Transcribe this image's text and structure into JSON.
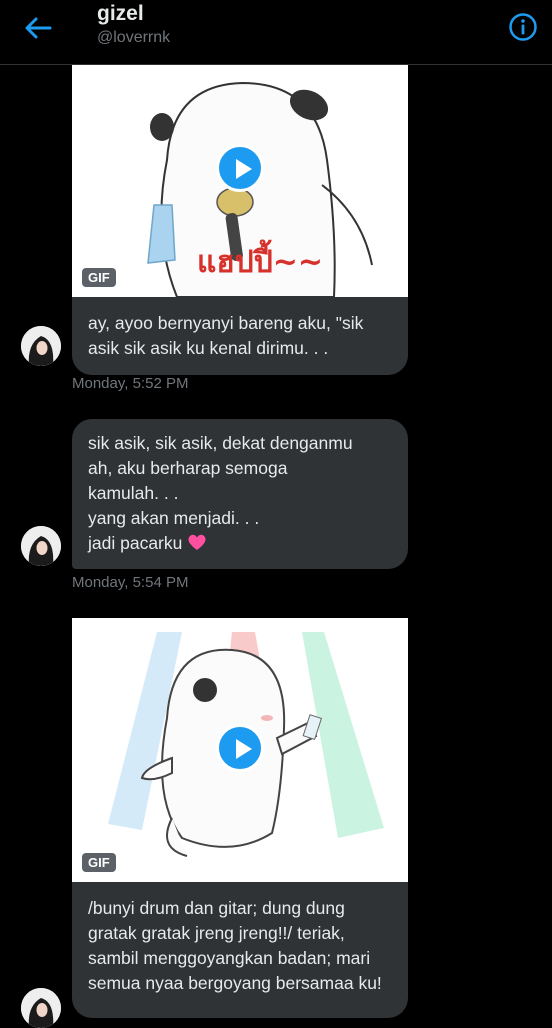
{
  "header": {
    "name": "gizel",
    "handle": "@loverrnk"
  },
  "messages": [
    {
      "type": "gif",
      "gif_badge": "GIF",
      "gif_caption": "แฮปปี้~~",
      "text": "ay, ayoo bernyanyi bareng aku, \"sik asik sik asik ku kenal dirimu. . .",
      "time": "Monday, 5:52 PM"
    },
    {
      "type": "text",
      "lines": [
        "sik asik, sik asik, dekat denganmu",
        "ah, aku berharap semoga",
        "kamulah. . .",
        "yang akan menjadi. . .",
        "jadi pacarku"
      ],
      "time": "Monday, 5:54 PM"
    },
    {
      "type": "gif",
      "gif_badge": "GIF",
      "text": "/bunyi drum dan gitar; dung dung gratak gratak jreng jreng!!/ teriak, sambil menggoyangkan badan; mari semua nyaa bergoyang bersamaa ku!"
    }
  ],
  "colors": {
    "accent": "#1d9bf0",
    "bubble": "#2f3336",
    "muted": "#71767b",
    "heart": "#ff4fa0"
  }
}
